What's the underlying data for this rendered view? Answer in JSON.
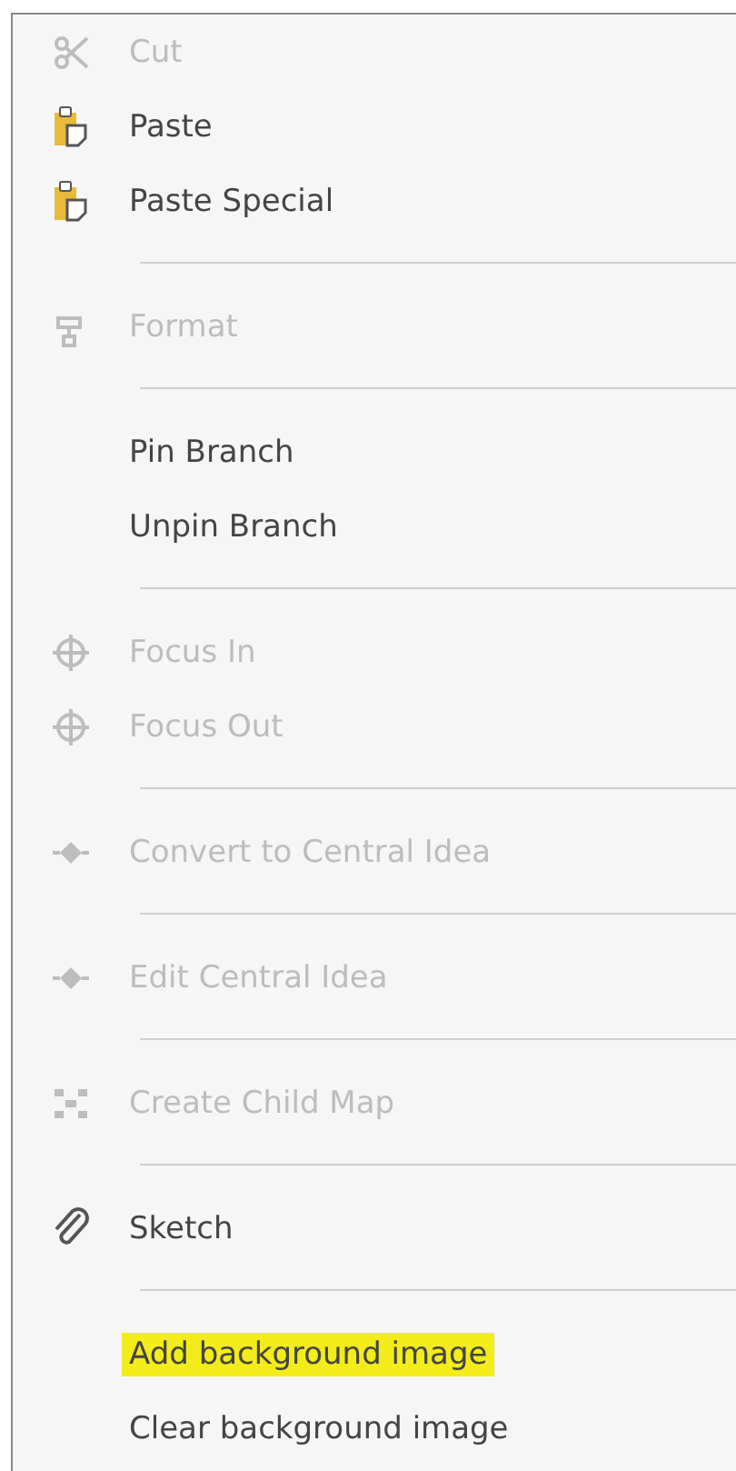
{
  "menu": {
    "groups": [
      {
        "items": [
          {
            "label": "Cut",
            "kind": "scissors",
            "disabled": true,
            "highlighted": false
          },
          {
            "label": "Paste",
            "kind": "clipboard",
            "disabled": false,
            "highlighted": false
          },
          {
            "label": "Paste Special",
            "kind": "clipboard",
            "disabled": false,
            "highlighted": false
          }
        ]
      },
      {
        "items": [
          {
            "label": "Format",
            "kind": "format",
            "disabled": true,
            "highlighted": false
          }
        ]
      },
      {
        "items": [
          {
            "label": "Pin Branch",
            "kind": "plain",
            "disabled": false,
            "highlighted": false
          },
          {
            "label": "Unpin Branch",
            "kind": "plain",
            "disabled": false,
            "highlighted": false
          }
        ]
      },
      {
        "items": [
          {
            "label": "Focus In",
            "kind": "focus",
            "disabled": true,
            "highlighted": false
          },
          {
            "label": "Focus Out",
            "kind": "focus",
            "disabled": true,
            "highlighted": false
          }
        ]
      },
      {
        "items": [
          {
            "label": "Convert to Central Idea",
            "kind": "node",
            "disabled": true,
            "highlighted": false
          }
        ]
      },
      {
        "items": [
          {
            "label": "Edit Central Idea",
            "kind": "node",
            "disabled": true,
            "highlighted": false
          }
        ]
      },
      {
        "items": [
          {
            "label": "Create Child Map",
            "kind": "map",
            "disabled": true,
            "highlighted": false
          }
        ]
      },
      {
        "items": [
          {
            "label": "Sketch",
            "kind": "clip",
            "disabled": false,
            "highlighted": false
          }
        ]
      },
      {
        "items": [
          {
            "label": "Add background image",
            "kind": "plain",
            "disabled": false,
            "highlighted": true
          },
          {
            "label": "Clear background image",
            "kind": "plain",
            "disabled": false,
            "highlighted": false
          }
        ]
      }
    ]
  }
}
